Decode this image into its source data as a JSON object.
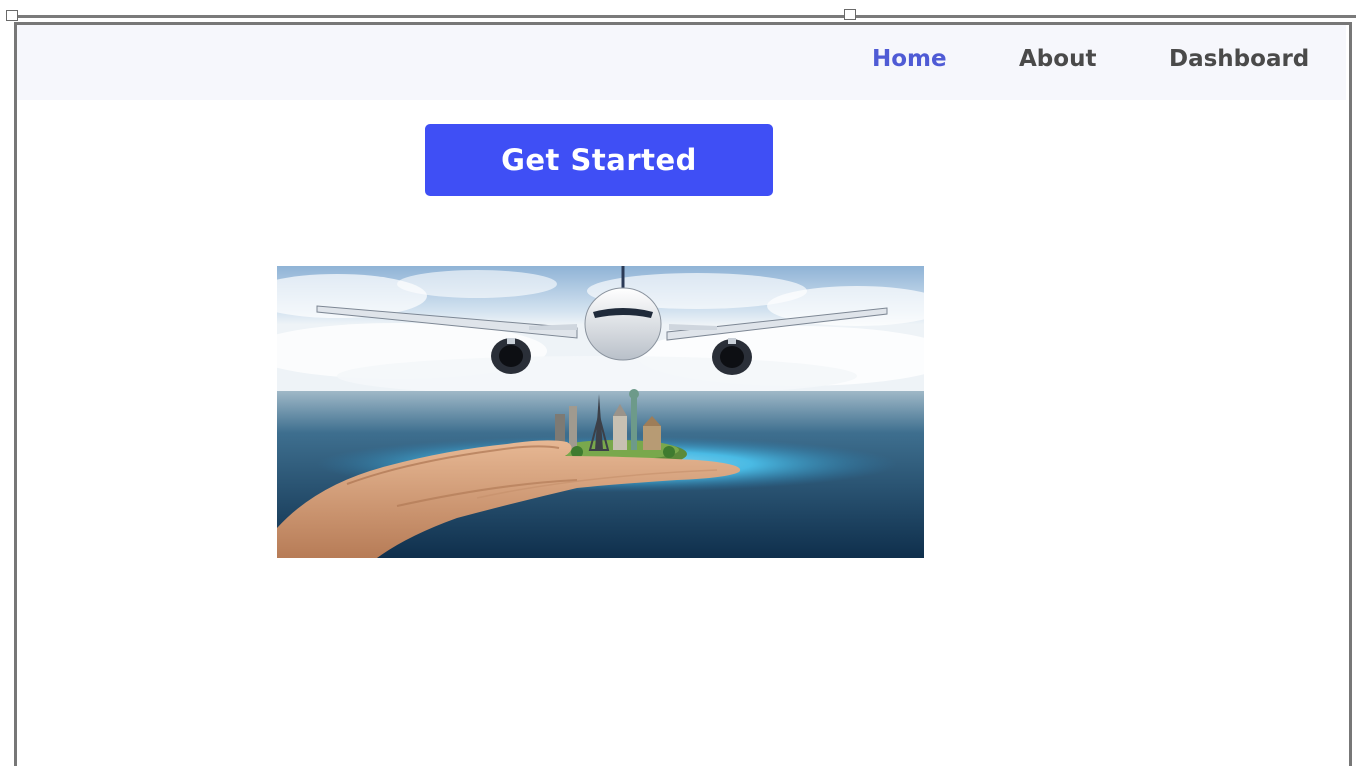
{
  "nav": {
    "items": [
      {
        "label": "Home",
        "active": true
      },
      {
        "label": "About",
        "active": false
      },
      {
        "label": "Dashboard",
        "active": false
      }
    ],
    "active_color": "#4f5bd5",
    "inactive_color": "#4a4a4a"
  },
  "hero": {
    "cta_label": "Get Started",
    "cta_color": "#3f4ff5",
    "image_icon": "airplane-over-hand-holding-landmarks-image"
  }
}
